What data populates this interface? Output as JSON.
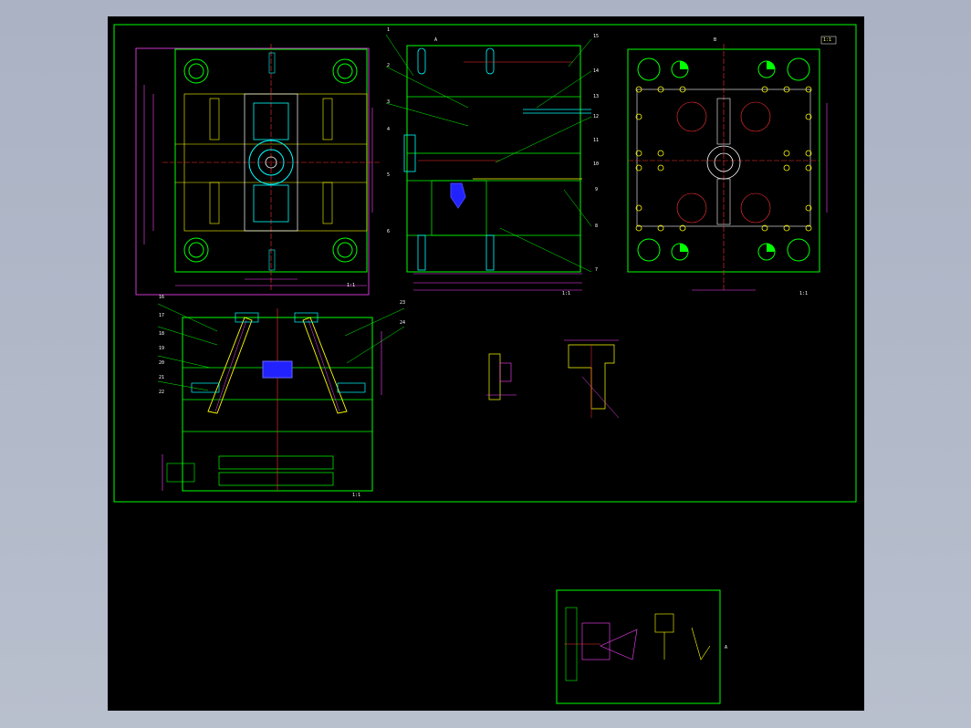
{
  "colors": {
    "background": "#000000",
    "border": "#00ff00",
    "outline": "#00ff00",
    "dimension": "#ff44ff",
    "centerline": "#ff3333",
    "part": "#00ffff",
    "highlight": "#ffff00",
    "accent": "#2222ff",
    "text": "#ffffff"
  },
  "labels": {
    "view1_scale": "1:1",
    "view2_scale": "1:1",
    "view3_scale": "1:1",
    "view4_scale": "1:1",
    "section_mark_a": "A",
    "section_mark_b": "B",
    "note_text": "1:1",
    "detail_small": "A"
  },
  "balloons_center": [
    "1",
    "2",
    "3",
    "4",
    "5",
    "6",
    "7",
    "8",
    "9",
    "10",
    "11",
    "12",
    "13",
    "14",
    "15"
  ],
  "balloons_lower": [
    "16",
    "17",
    "18",
    "19",
    "20",
    "21",
    "22",
    "23",
    "24"
  ]
}
